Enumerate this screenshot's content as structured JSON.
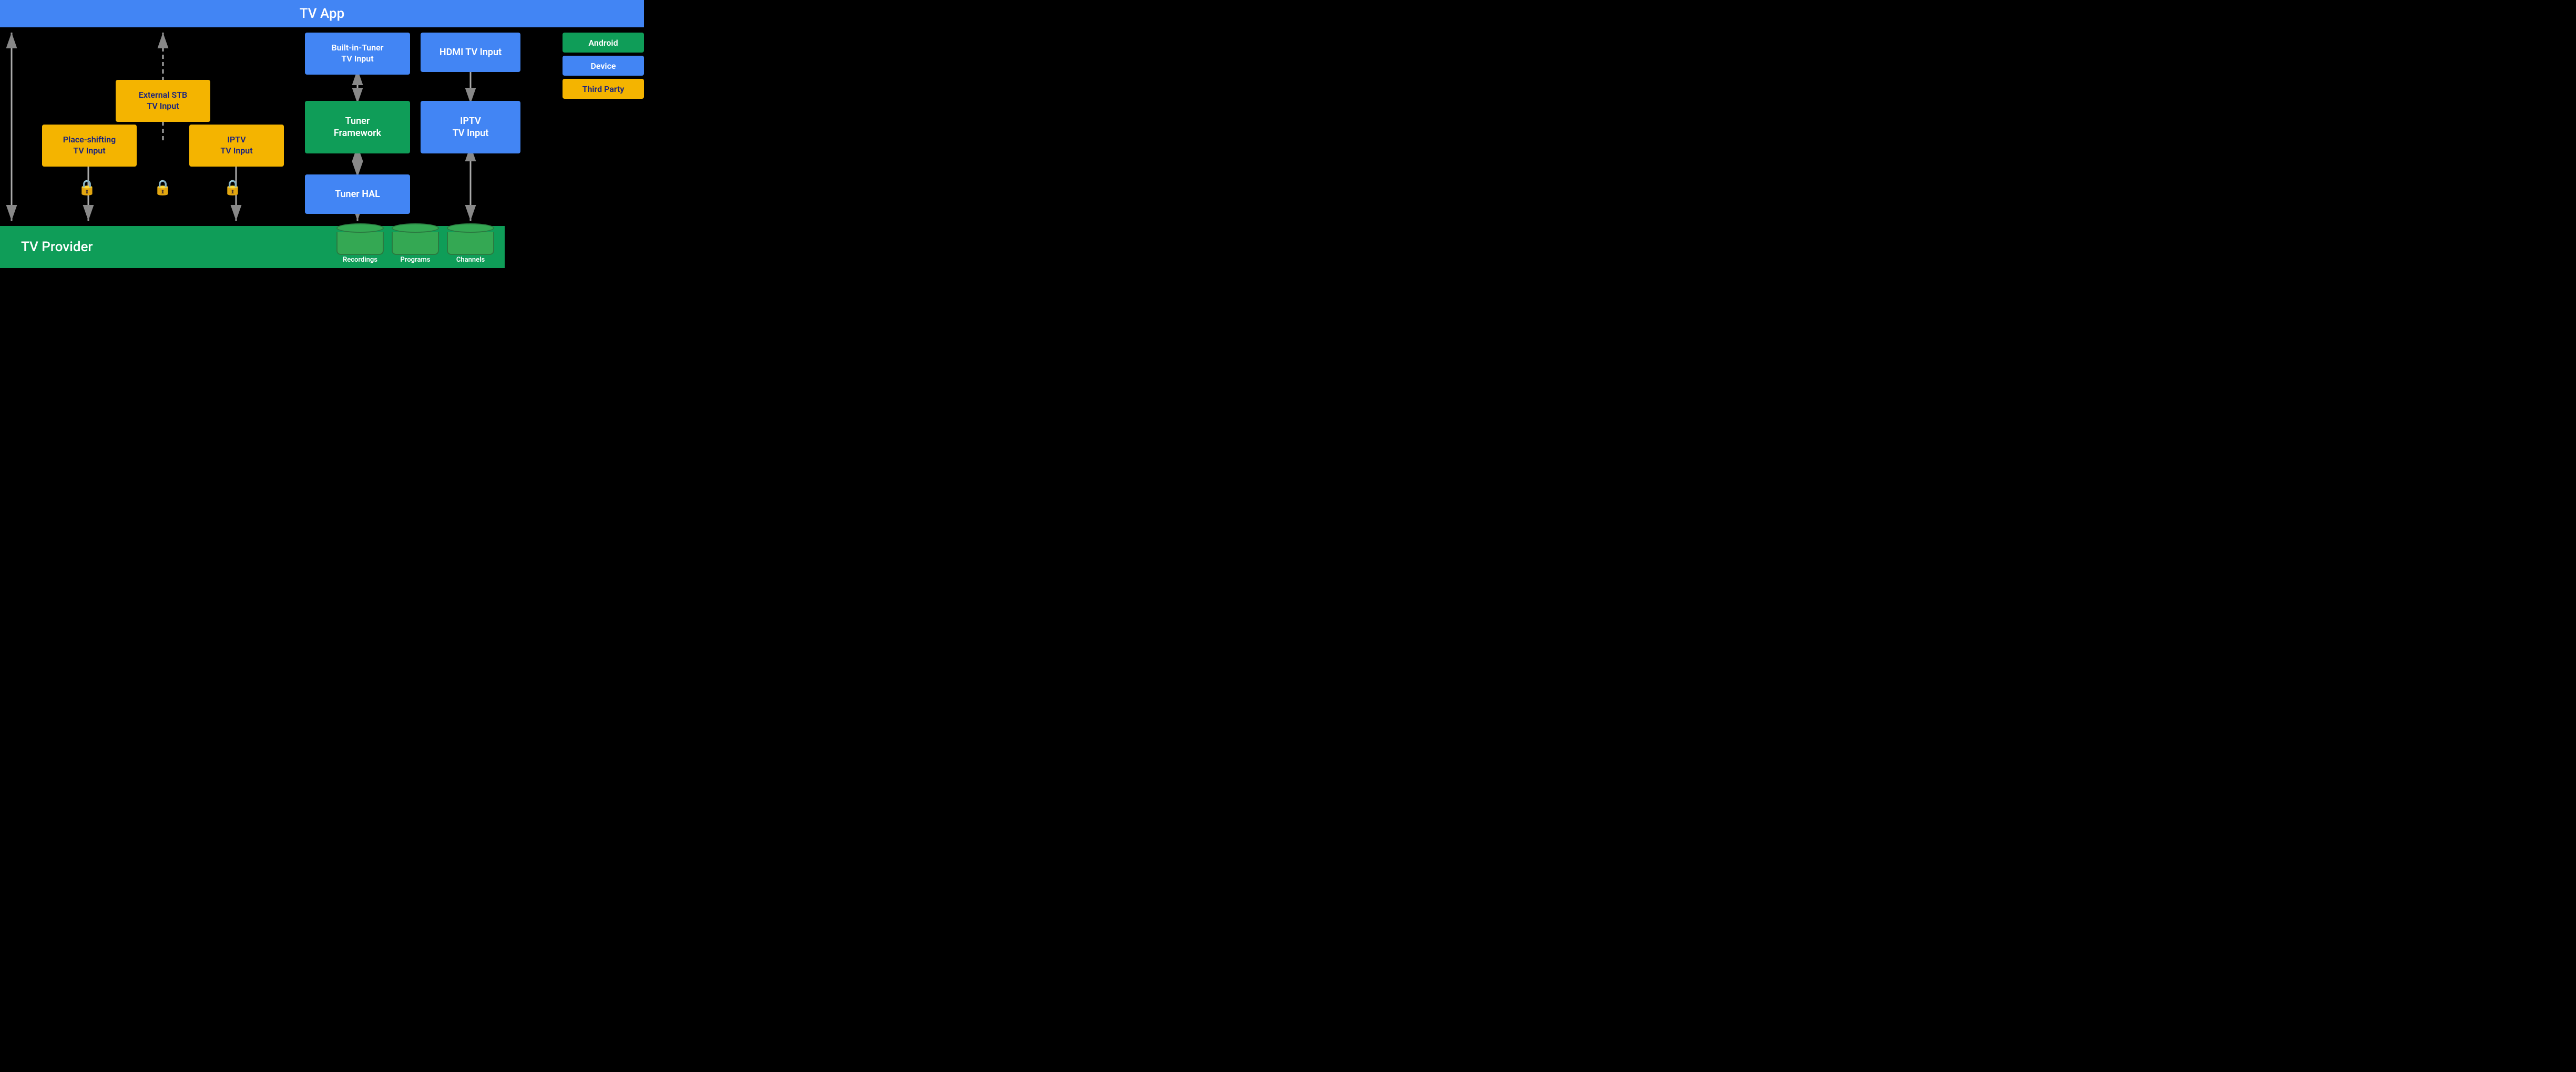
{
  "header": {
    "title": "TV App"
  },
  "footer": {
    "title": "TV Provider"
  },
  "legend": {
    "items": [
      {
        "label": "Android",
        "color": "green"
      },
      {
        "label": "Device",
        "color": "blue"
      },
      {
        "label": "Third Party",
        "color": "orange"
      }
    ]
  },
  "boxes": {
    "external_stb": "External STB\nTV Input",
    "place_shifting": "Place-shifting\nTV Input",
    "iptv_left": "IPTV\nTV Input",
    "built_in_tuner": "Built-in-Tuner\nTV Input",
    "tuner_framework": "Tuner\nFramework",
    "tuner_hal": "Tuner HAL",
    "hdmi_tv_input": "HDMI TV Input",
    "iptv_right": "IPTV\nTV Input"
  },
  "cylinders": [
    {
      "label": "Recordings"
    },
    {
      "label": "Programs"
    },
    {
      "label": "Channels"
    }
  ]
}
